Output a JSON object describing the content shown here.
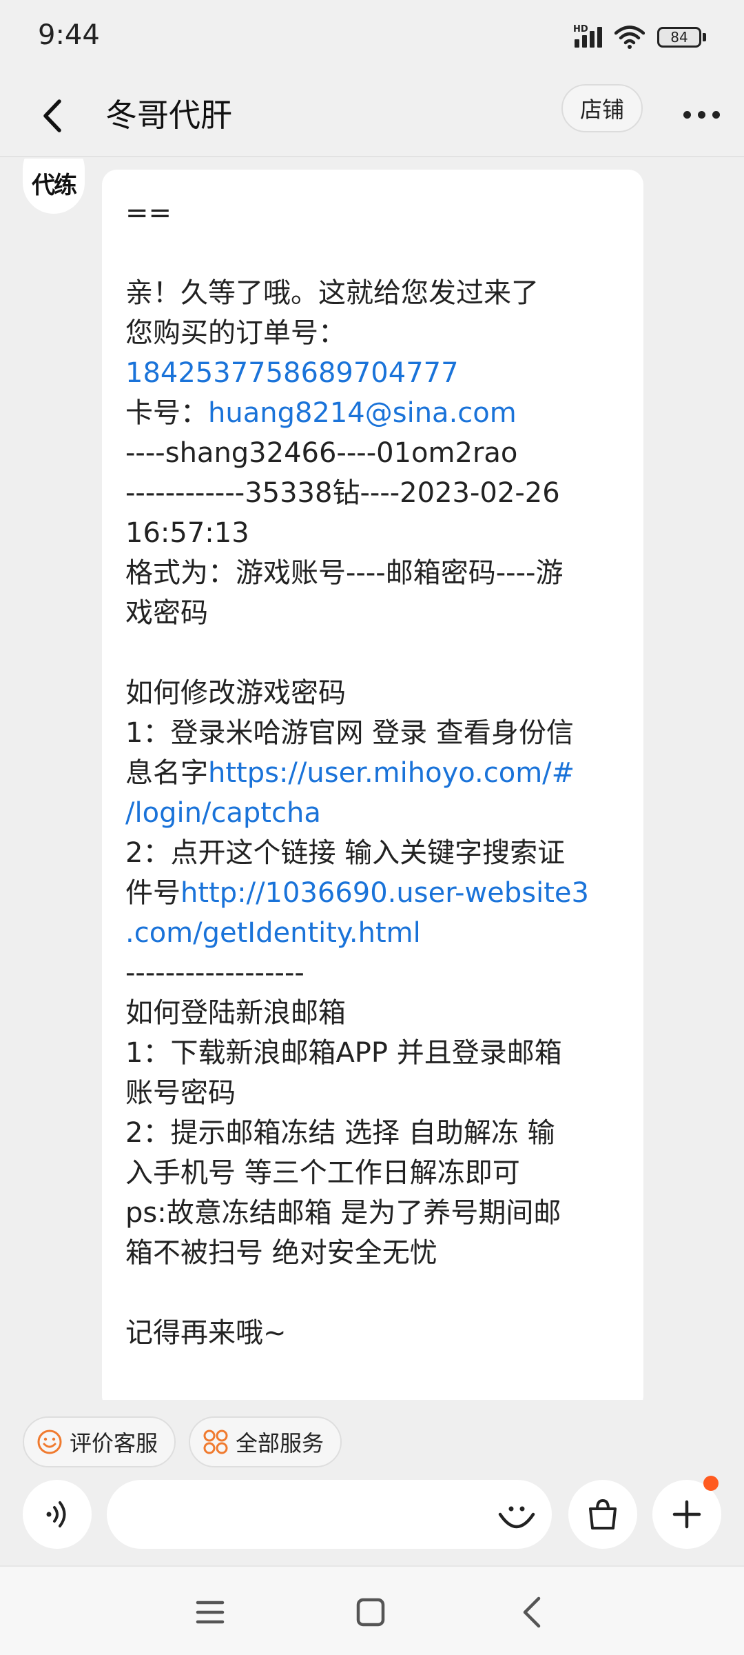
{
  "status_bar": {
    "time": "9:44",
    "network_label": "HD",
    "battery_level": "84"
  },
  "header": {
    "title": "冬哥代肝",
    "shop_label": "店铺"
  },
  "avatar": {
    "text": "代练"
  },
  "message": {
    "lines": [
      {
        "text": "=="
      },
      {
        "text": ""
      },
      {
        "text": "亲！久等了哦。这就给您发过来了"
      },
      {
        "text": "您购买的订单号："
      },
      {
        "text": "1842537758689704777",
        "link": true
      },
      {
        "prefix": "卡号：",
        "text": "huang8214@sina.com",
        "link": true
      },
      {
        "text": "----shang32466----01om2rao"
      },
      {
        "text": "------------35338钻----2023-02-26"
      },
      {
        "text": "16:57:13"
      },
      {
        "text": "格式为：游戏账号----邮箱密码----游"
      },
      {
        "text": "戏密码"
      },
      {
        "text": ""
      },
      {
        "text": "如何修改游戏密码"
      },
      {
        "text": "1：登录米哈游官网 登录 查看身份信"
      },
      {
        "prefix": "息名字",
        "text": "https://user.mihoyo.com/#",
        "link": true
      },
      {
        "text": "/login/captcha",
        "link": true
      },
      {
        "text": "2：点开这个链接 输入关键字搜索证"
      },
      {
        "prefix": "件号",
        "text": "http://1036690.user-website3",
        "link": true
      },
      {
        "text": ".com/getIdentity.html",
        "link": true
      },
      {
        "text": "------------------"
      },
      {
        "text": "如何登陆新浪邮箱"
      },
      {
        "text": "1：下载新浪邮箱APP 并且登录邮箱"
      },
      {
        "text": "账号密码"
      },
      {
        "text": "2：提示邮箱冻结 选择 自助解冻 输"
      },
      {
        "text": "入手机号 等三个工作日解冻即可"
      },
      {
        "text": "ps:故意冻结邮箱 是为了养号期间邮"
      },
      {
        "text": "箱不被扫号 绝对安全无忧"
      },
      {
        "text": ""
      },
      {
        "text": "记得再来哦~"
      }
    ]
  },
  "quick_actions": {
    "rate_service": "评价客服",
    "all_services": "全部服务"
  },
  "input": {
    "placeholder": ""
  },
  "colors": {
    "link": "#1a73d9",
    "accent": "#f07a2e",
    "badge": "#ff5a1f"
  }
}
